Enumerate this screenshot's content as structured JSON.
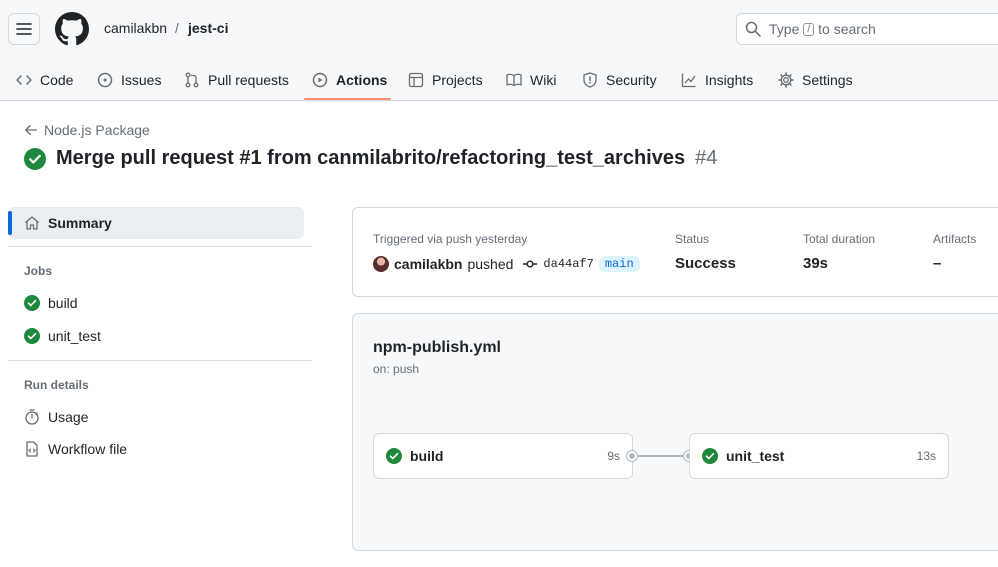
{
  "header": {
    "owner": "camilakbn",
    "separator": "/",
    "repo": "jest-ci",
    "search_prefix": "Type",
    "search_key": "/",
    "search_suffix": "to search"
  },
  "tabs": [
    {
      "label": "Code",
      "icon": "code-icon"
    },
    {
      "label": "Issues",
      "icon": "issue-icon"
    },
    {
      "label": "Pull requests",
      "icon": "pull-request-icon"
    },
    {
      "label": "Actions",
      "icon": "play-icon",
      "active": true
    },
    {
      "label": "Projects",
      "icon": "table-icon"
    },
    {
      "label": "Wiki",
      "icon": "book-icon"
    },
    {
      "label": "Security",
      "icon": "shield-icon"
    },
    {
      "label": "Insights",
      "icon": "graph-icon"
    },
    {
      "label": "Settings",
      "icon": "gear-icon"
    }
  ],
  "run": {
    "back_label": "Node.js Package",
    "title": "Merge pull request #1 from canmilabrito/refactoring_test_archives",
    "run_number": "#4"
  },
  "sidebar": {
    "summary_label": "Summary",
    "jobs_heading": "Jobs",
    "jobs": [
      {
        "label": "build"
      },
      {
        "label": "unit_test"
      }
    ],
    "run_details_heading": "Run details",
    "details": [
      {
        "label": "Usage",
        "icon": "stopwatch-icon"
      },
      {
        "label": "Workflow file",
        "icon": "file-code-icon"
      }
    ]
  },
  "summary": {
    "triggered_label": "Triggered via push yesterday",
    "actor": "camilakbn",
    "action": "pushed",
    "commit_sha": "da44af7",
    "branch": "main",
    "status_label": "Status",
    "status_value": "Success",
    "duration_label": "Total duration",
    "duration_value": "39s",
    "artifacts_label": "Artifacts",
    "artifacts_value": "–"
  },
  "workflow": {
    "file_name": "npm-publish.yml",
    "trigger": "on: push",
    "jobs": [
      {
        "name": "build",
        "duration": "9s"
      },
      {
        "name": "unit_test",
        "duration": "13s"
      }
    ]
  },
  "colors": {
    "success": "#1f883d",
    "accent": "#0969da",
    "active_tab_underline": "#fd8c73"
  }
}
